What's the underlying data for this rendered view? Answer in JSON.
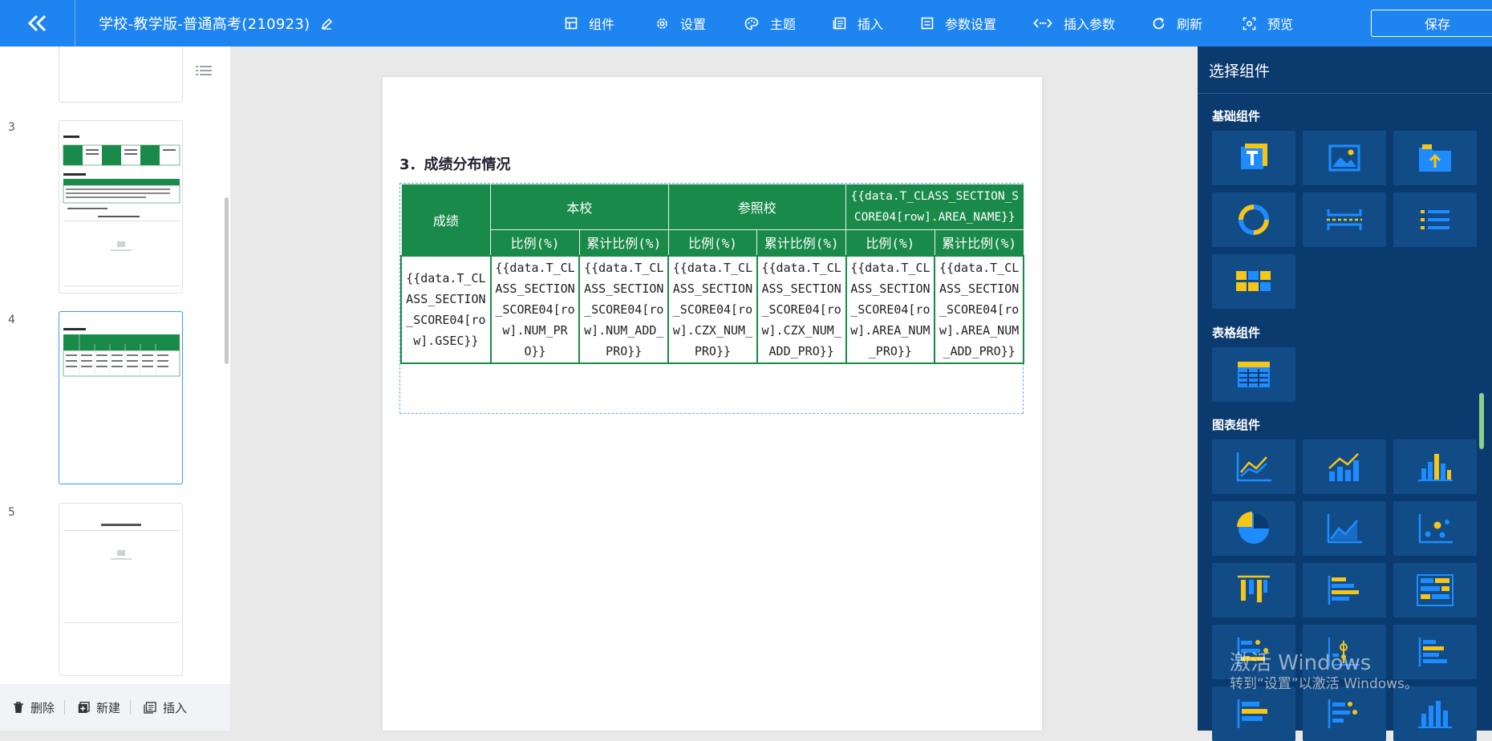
{
  "header": {
    "doc_title": "学校-教学版-普通高考(210923)",
    "tools": [
      {
        "label": "组件",
        "icon": "component-icon"
      },
      {
        "label": "设置",
        "icon": "gear-icon"
      },
      {
        "label": "主题",
        "icon": "palette-icon"
      },
      {
        "label": "插入",
        "icon": "insert-icon"
      },
      {
        "label": "参数设置",
        "icon": "param-settings-icon"
      },
      {
        "label": "插入参数",
        "icon": "code-icon"
      },
      {
        "label": "刷新",
        "icon": "refresh-icon"
      },
      {
        "label": "预览",
        "icon": "preview-icon"
      }
    ],
    "save_label": "保存"
  },
  "pages_panel": {
    "pages": [
      {
        "num": "3"
      },
      {
        "num": "4",
        "active": true
      },
      {
        "num": "5"
      }
    ],
    "footer": {
      "delete": "删除",
      "new": "新建",
      "insert": "插入"
    }
  },
  "document": {
    "section_title": "3．成绩分布情况",
    "table": {
      "head_row1": [
        "成绩",
        "本校",
        "参照校",
        "{{data.T_CLASS_SECTION_SCORE04[row].AREA_NAME}}"
      ],
      "head_row2": [
        "比例(%)",
        "累计比例(%)",
        "比例(%)",
        "累计比例(%)",
        "比例(%)",
        "累计比例(%)"
      ],
      "body_row": [
        "{{data.T_CLASS_SECTION_SCORE04[row].GSEC}}",
        "{{data.T_CLASS_SECTION_SCORE04[row].NUM_PRO}}",
        "{{data.T_CLASS_SECTION_SCORE04[row].NUM_ADD_PRO}}",
        "{{data.T_CLASS_SECTION_SCORE04[row].CZX_NUM_PRO}}",
        "{{data.T_CLASS_SECTION_SCORE04[row].CZX_NUM_ADD_PRO}}",
        "{{data.T_CLASS_SECTION_SCORE04[row].AREA_NUM_PRO}}",
        "{{data.T_CLASS_SECTION_SCORE04[row].AREA_NUM_ADD_PRO}}"
      ]
    }
  },
  "component_panel": {
    "title": "选择组件",
    "groups": {
      "basic": "基础组件",
      "table": "表格组件",
      "chart": "图表组件"
    }
  },
  "watermark": {
    "line1": "激活 Windows",
    "line2": "转到“设置”以激活 Windows。"
  },
  "colors": {
    "header_bg": "#1e84f0",
    "table_green": "#1a8a4a",
    "panel_bg": "#0a3a6e",
    "tile_bg": "#124c87",
    "icon_yellow": "#f5c518",
    "icon_blue": "#1e8cff"
  }
}
